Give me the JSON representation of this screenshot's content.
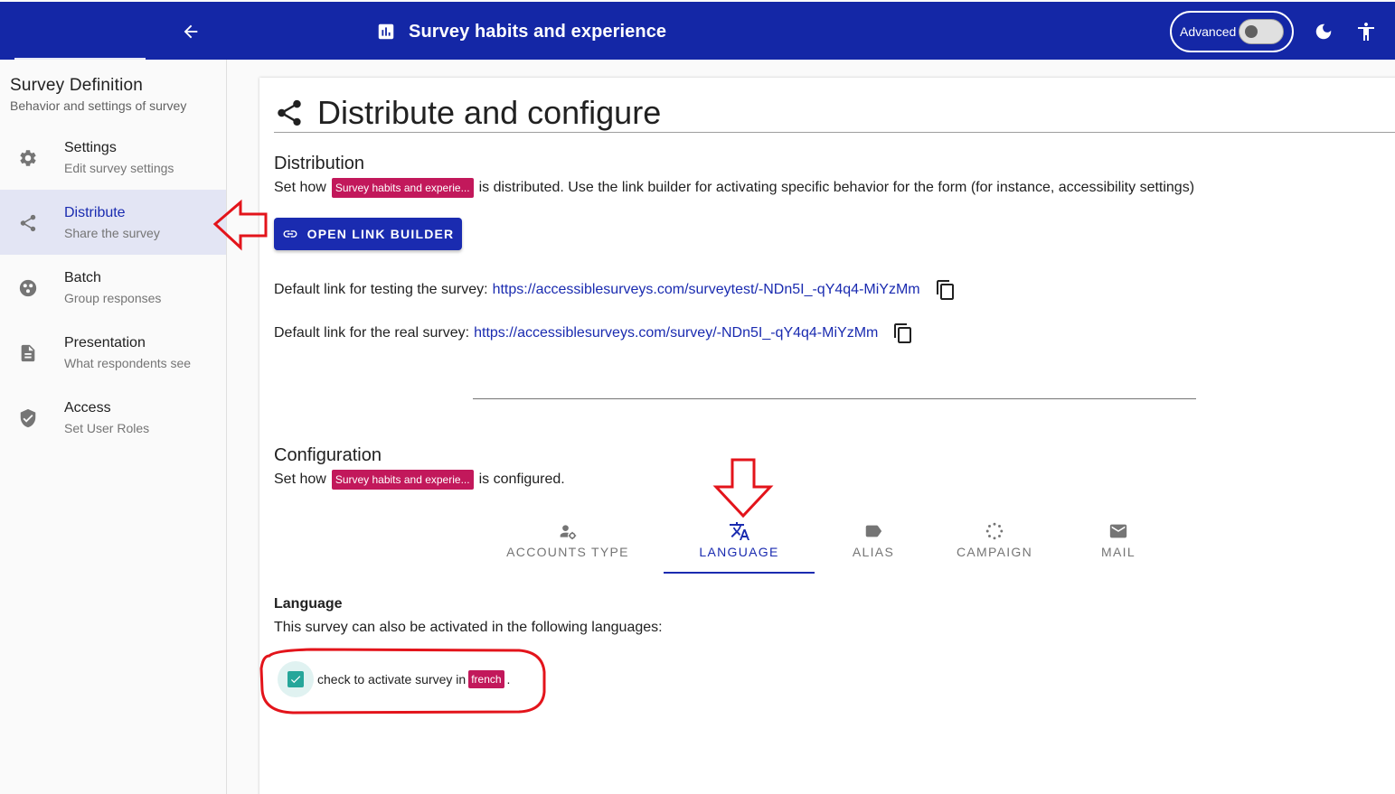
{
  "appbar": {
    "title": "Survey habits and experience",
    "advanced_label": "Advanced",
    "advanced_enabled": false
  },
  "sidebar": {
    "title": "Survey Definition",
    "subtitle": "Behavior and settings of survey",
    "items": [
      {
        "label": "Settings",
        "sub": "Edit survey settings",
        "icon": "gear-icon"
      },
      {
        "label": "Distribute",
        "sub": "Share the survey",
        "icon": "share-icon",
        "active": true
      },
      {
        "label": "Batch",
        "sub": "Group responses",
        "icon": "batch-icon"
      },
      {
        "label": "Presentation",
        "sub": "What respondents see",
        "icon": "document-icon"
      },
      {
        "label": "Access",
        "sub": "Set User Roles",
        "icon": "shield-icon"
      }
    ]
  },
  "main": {
    "heading": "Distribute and configure",
    "distribution": {
      "title": "Distribution",
      "text_before": "Set how",
      "survey_chip": "Survey habits and experie...",
      "text_after": "is distributed. Use the link builder for activating specific behavior for the form (for instance, accessibility settings)",
      "button_label": "OPEN LINK BUILDER",
      "test_link_label": "Default link for testing the survey:",
      "test_link_url": "https://accessiblesurveys.com/surveytest/-NDn5I_-qY4q4-MiYzMm",
      "real_link_label": "Default link for the real survey:",
      "real_link_url": "https://accessiblesurveys.com/survey/-NDn5I_-qY4q4-MiYzMm"
    },
    "configuration": {
      "title": "Configuration",
      "text_before": "Set how",
      "survey_chip": "Survey habits and experie...",
      "text_after": "is configured.",
      "tabs": [
        {
          "label": "ACCOUNTS TYPE",
          "icon": "account-settings-icon"
        },
        {
          "label": "LANGUAGE",
          "icon": "translate-icon",
          "active": true
        },
        {
          "label": "ALIAS",
          "icon": "label-icon"
        },
        {
          "label": "CAMPAIGN",
          "icon": "campaign-icon"
        },
        {
          "label": "MAIL",
          "icon": "mail-icon"
        }
      ]
    },
    "language": {
      "title": "Language",
      "description": "This survey can also be activated in the following languages:",
      "check_label": "check to activate survey in",
      "language_chip": "french",
      "checked": true,
      "check_suffix": "."
    }
  },
  "colors": {
    "primary": "#1427a6",
    "chip": "#c2185b",
    "checkbox": "#26a69a",
    "annotation": "#e3141b"
  }
}
